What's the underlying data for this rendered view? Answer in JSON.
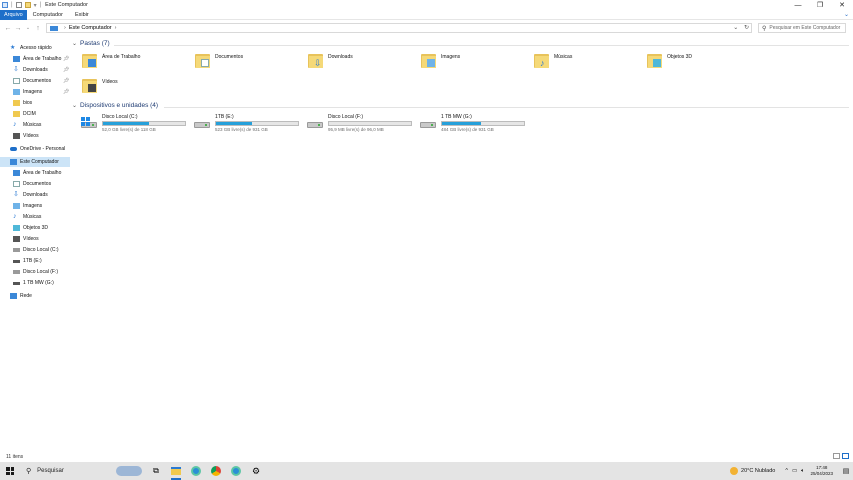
{
  "window": {
    "title": "Este Computador",
    "controls": {
      "minimize": "—",
      "maximize": "❐",
      "close": "✕"
    }
  },
  "ribbon": {
    "tabs": [
      "Arquivo",
      "Computador",
      "Exibir"
    ],
    "expand_icon": "chevron-down-icon"
  },
  "address": {
    "path": [
      "Este Computador"
    ],
    "search_placeholder": "Pesquisar em Este Computador"
  },
  "sidebar": {
    "items": [
      {
        "label": "Acesso rápido",
        "icon": "star-icon",
        "pinned": false
      },
      {
        "label": "Área de Trabalho",
        "icon": "desktop-icon",
        "pinned": true
      },
      {
        "label": "Downloads",
        "icon": "download-icon",
        "pinned": true
      },
      {
        "label": "Documentos",
        "icon": "document-icon",
        "pinned": true
      },
      {
        "label": "Imagens",
        "icon": "image-icon",
        "pinned": true
      },
      {
        "label": "bios",
        "icon": "folder-icon",
        "pinned": false
      },
      {
        "label": "DCIM",
        "icon": "folder-icon",
        "pinned": false
      },
      {
        "label": "Músicas",
        "icon": "music-icon",
        "pinned": false
      },
      {
        "label": "Vídeos",
        "icon": "video-icon",
        "pinned": false
      },
      {
        "label": "OneDrive - Personal",
        "icon": "cloud-icon",
        "pinned": false
      },
      {
        "label": "Este Computador",
        "icon": "computer-icon",
        "pinned": false
      },
      {
        "label": "Área de Trabalho",
        "icon": "desktop-icon",
        "pinned": false
      },
      {
        "label": "Documentos",
        "icon": "document-icon",
        "pinned": false
      },
      {
        "label": "Downloads",
        "icon": "download-icon",
        "pinned": false
      },
      {
        "label": "Imagens",
        "icon": "image-icon",
        "pinned": false
      },
      {
        "label": "Músicas",
        "icon": "music-icon",
        "pinned": false
      },
      {
        "label": "Objetos 3D",
        "icon": "cube-icon",
        "pinned": false
      },
      {
        "label": "Vídeos",
        "icon": "video-icon",
        "pinned": false
      },
      {
        "label": "Disco Local (C:)",
        "icon": "windows-drive-icon",
        "pinned": false
      },
      {
        "label": "1TB (E:)",
        "icon": "drive-icon",
        "pinned": false
      },
      {
        "label": "Disco Local (F:)",
        "icon": "drive-icon",
        "pinned": false
      },
      {
        "label": "1 TB MW  (G:)",
        "icon": "drive-icon",
        "pinned": false
      },
      {
        "label": "Rede",
        "icon": "network-icon",
        "pinned": false
      }
    ]
  },
  "folders_group": {
    "title": "Pastas (7)",
    "items": [
      {
        "label": "Área de Trabalho",
        "badge": "desktop-icon"
      },
      {
        "label": "Documentos",
        "badge": "document-icon"
      },
      {
        "label": "Downloads",
        "badge": "download-icon"
      },
      {
        "label": "Imagens",
        "badge": "image-icon"
      },
      {
        "label": "Músicas",
        "badge": "music-icon"
      },
      {
        "label": "Objetos 3D",
        "badge": "cube-icon"
      },
      {
        "label": "Vídeos",
        "badge": "video-icon"
      }
    ]
  },
  "drives_group": {
    "title": "Dispositivos e unidades (4)",
    "items": [
      {
        "name": "Disco Local (C:)",
        "free": "52,0 GB livre(s) de 118 GB",
        "used_fraction": 0.56,
        "icon": "windows-drive-icon"
      },
      {
        "name": "1TB (E:)",
        "free": "523 GB livre(s) de 931 GB",
        "used_fraction": 0.44,
        "icon": "drive-icon"
      },
      {
        "name": "Disco Local (F:)",
        "free": "95,9 MB livre(s) de 96,0 MB",
        "used_fraction": 0.0,
        "icon": "drive-icon"
      },
      {
        "name": "1 TB MW  (G:)",
        "free": "484 GB livre(s) de 931 GB",
        "used_fraction": 0.48,
        "icon": "drive-icon"
      }
    ]
  },
  "status": {
    "count": "11 itens"
  },
  "taskbar": {
    "search_label": "Pesquisar",
    "apps": [
      "cortana-widget-icon",
      "task-view-icon",
      "file-explorer-icon",
      "edge-icon",
      "chrome-icon",
      "edge-icon",
      "settings-icon"
    ],
    "weather": "20°C  Nublado",
    "time": "17:48",
    "date": "25/04/2023"
  },
  "colors": {
    "accent": "#1e6fc9",
    "selected": "#cce4f7",
    "bar_fill": "#26a0da",
    "group_title": "#1e3b72"
  }
}
